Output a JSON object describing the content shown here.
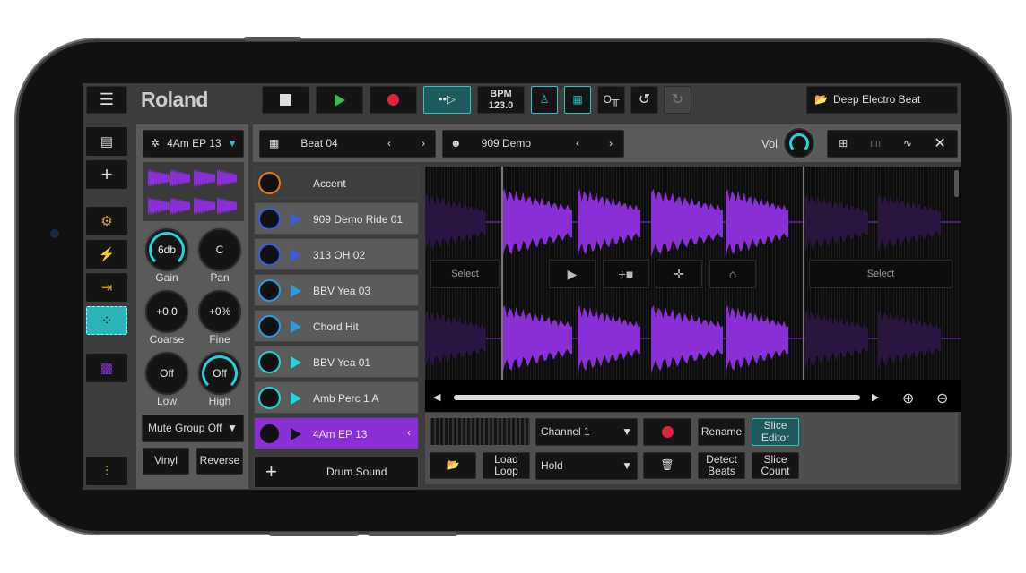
{
  "header": {
    "brand": "Roland",
    "bpm_label": "BPM",
    "bpm_value": "123.0",
    "project": "Deep Electro Beat"
  },
  "instrument": {
    "name": "4Am EP 13",
    "knobs": [
      {
        "label": "Gain",
        "value": "6db"
      },
      {
        "label": "Pan",
        "value": "C"
      },
      {
        "label": "Coarse",
        "value": "+0.0"
      },
      {
        "label": "Fine",
        "value": "+0%"
      },
      {
        "label": "Low",
        "value": "Off"
      },
      {
        "label": "High",
        "value": "Off"
      }
    ],
    "mute_group": "Mute Group Off",
    "vinyl": "Vinyl",
    "reverse": "Reverse"
  },
  "beat": {
    "name": "Beat 04",
    "kit": "909 Demo",
    "vol_label": "Vol"
  },
  "pads": [
    {
      "label": "Accent",
      "color": "#e07a20"
    },
    {
      "label": "909 Demo Ride 01",
      "color": "#3b5bdc"
    },
    {
      "label": "313 OH 02",
      "color": "#3b5bdc"
    },
    {
      "label": "BBV Yea 03",
      "color": "#2a9be0"
    },
    {
      "label": "Chord Hit",
      "color": "#2a9be0"
    },
    {
      "label": "BBV Yea 01",
      "color": "#22d4dc"
    },
    {
      "label": "Amb Perc 1 A",
      "color": "#22d4dc"
    },
    {
      "label": "4Am EP 13",
      "color": "#8a2fd6",
      "selected": true
    }
  ],
  "add_pad": "Drum Sound",
  "editor": {
    "select_left": "Select",
    "select_right": "Select",
    "waveform_color": "#8a2fd6"
  },
  "bottom": {
    "channel": "Channel 1",
    "mode": "Hold",
    "rename": "Rename",
    "slice_editor": "Slice Editor",
    "load_loop": "Load Loop",
    "detect_beats": "Detect Beats",
    "slice_count": "Slice Count"
  },
  "colors": {
    "accent": "#2bc5c8",
    "record": "#e0213f",
    "play": "#2fbf4a",
    "purple": "#8a2fd6"
  }
}
